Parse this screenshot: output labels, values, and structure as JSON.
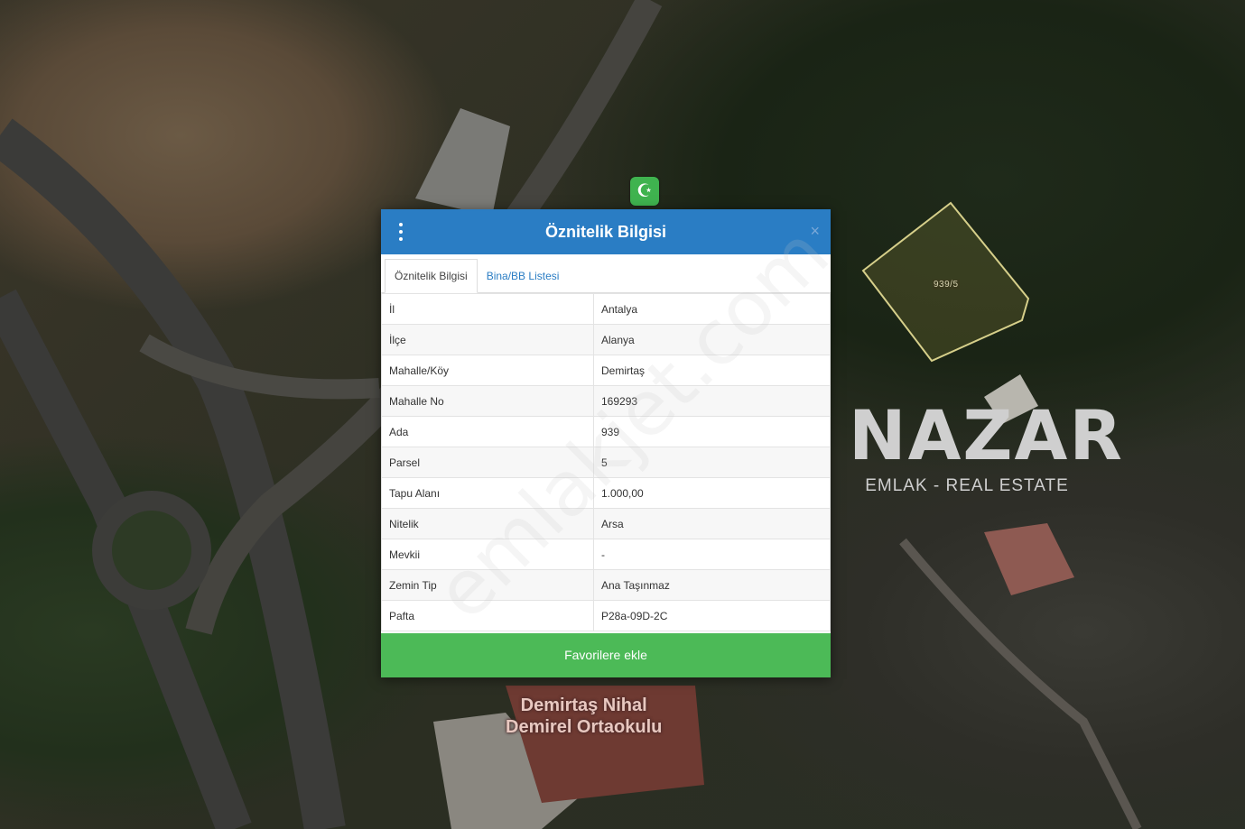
{
  "map": {
    "parcel_label": "939/5",
    "school_label_line1": "Demirtaş Nihal",
    "school_label_line2": "Demirel Ortaokulu",
    "mosque_icon": "crescent-star-icon"
  },
  "brand": {
    "name": "NAZAR",
    "subtitle": "EMLAK - REAL ESTATE"
  },
  "watermark": "emlakjet.com",
  "dialog": {
    "title": "Öznitelik Bilgisi",
    "close_glyph": "×",
    "tabs": [
      {
        "label": "Öznitelik Bilgisi",
        "active": true
      },
      {
        "label": "Bina/BB Listesi",
        "active": false
      }
    ],
    "rows": [
      {
        "key": "İl",
        "value": "Antalya"
      },
      {
        "key": "İlçe",
        "value": "Alanya"
      },
      {
        "key": "Mahalle/Köy",
        "value": "Demirtaş"
      },
      {
        "key": "Mahalle No",
        "value": "169293"
      },
      {
        "key": "Ada",
        "value": "939"
      },
      {
        "key": "Parsel",
        "value": "5"
      },
      {
        "key": "Tapu Alanı",
        "value": "1.000,00"
      },
      {
        "key": "Nitelik",
        "value": "Arsa"
      },
      {
        "key": "Mevkii",
        "value": "-"
      },
      {
        "key": "Zemin Tip",
        "value": "Ana Taşınmaz"
      },
      {
        "key": "Pafta",
        "value": "P28a-09D-2C"
      }
    ],
    "favorite_button": "Favorilere ekle"
  },
  "colors": {
    "header": "#2a7dc4",
    "button": "#4cba57",
    "parcel_outline": "#d6cf8a"
  }
}
